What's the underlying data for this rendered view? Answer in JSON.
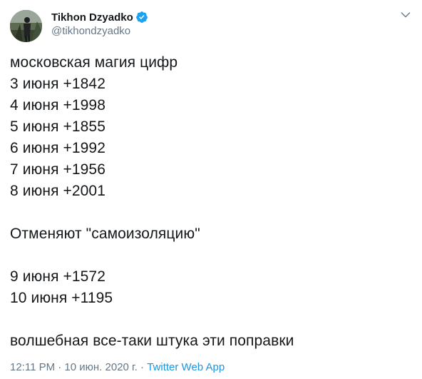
{
  "author": {
    "display_name": "Tikhon Dzyadko",
    "handle": "@tikhondzyadko",
    "verified": true,
    "verified_color": "#1da1f2"
  },
  "tweet": {
    "lines": [
      "московская магия цифр",
      "3 июня +1842",
      "4 июня +1998",
      "5 июня +1855",
      "6 июня +1992",
      "7 июня +1956",
      "8 июня +2001",
      "",
      "Отменяют \"самоизоляцию\"",
      "",
      "9 июня +1572",
      "10 июня +1195",
      "",
      "волшебная все-таки штука эти поправки"
    ]
  },
  "meta": {
    "timestamp": "12:11 PM · 10 июн. 2020 г.",
    "separator": " · ",
    "source": "Twitter Web App"
  },
  "icons": {
    "caret": "chevron-down-icon",
    "verified": "verified-badge-icon"
  },
  "colors": {
    "text": "#14171a",
    "secondary": "#657786",
    "link": "#1b95e0"
  }
}
